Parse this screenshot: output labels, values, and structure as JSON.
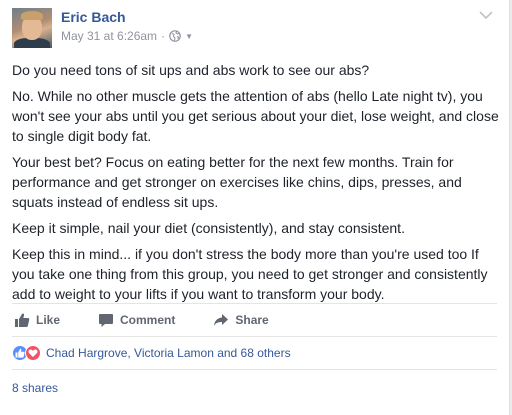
{
  "post": {
    "author": "Eric Bach",
    "timestamp": "May 31 at 6:26am",
    "meta_separator": "·",
    "privacy_icon": "globe-icon",
    "options_icon": "chevron-down-icon",
    "paragraphs": [
      "Do you need tons of sit ups and abs work to see our abs?",
      "No. While no other muscle gets the attention of abs (hello Late night tv), you won't see your abs until you get serious about your diet, lose weight, and close to single digit body fat.",
      "Your best bet? Focus on eating better for the next few months. Train for performance and get stronger on exercises like chins, dips, presses, and squats instead of endless sit ups.",
      "Keep it simple, nail your diet (consistently), and stay consistent.",
      "Keep this in mind... if you don't stress the body more than you're used too If you take one thing from this group, you need to get stronger and consistently add to weight to your lifts if you want to transform your body."
    ]
  },
  "actions": {
    "like": "Like",
    "comment": "Comment",
    "share": "Share"
  },
  "reactions": {
    "text": "Chad Hargrove, Victoria Lamon and 68 others",
    "icons": [
      "like-reaction-icon",
      "love-reaction-icon"
    ]
  },
  "shares": {
    "text": "8 shares"
  },
  "colors": {
    "link": "#365899",
    "text": "#1d2129",
    "muted": "#90949c",
    "like_reaction": "#5890ff",
    "love_reaction": "#f25268"
  }
}
